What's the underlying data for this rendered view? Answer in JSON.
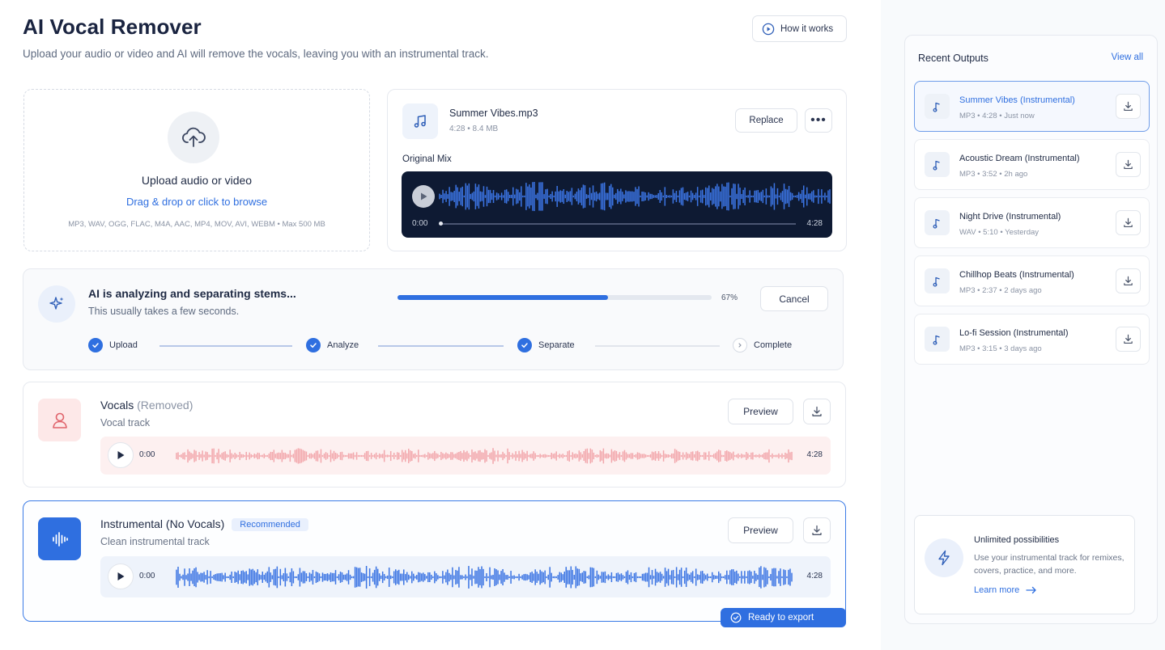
{
  "header": {
    "title": "AI Vocal Remover",
    "subtitle": "Upload your audio or video and AI  will remove the vocals, leaving you with an instrumental track.",
    "how_it_works": "How it works"
  },
  "upload": {
    "title": "Upload audio or video",
    "link": "Drag & drop or click to browse",
    "formats": "MP3, WAV, OGG, FLAC, M4A, AAC, MP4, MOV, AVI, WEBM • Max 500 MB"
  },
  "file": {
    "name": "Summer Vibes.mp3",
    "meta": "4:28  •  8.4 MB",
    "replace": "Replace",
    "more": "•••",
    "original_label": "Original Mix",
    "time_current": "0:00",
    "time_total": "4:28"
  },
  "progress": {
    "title": "AI is analyzing and separating stems...",
    "subtitle": "This usually takes a few seconds.",
    "percent_value": 67,
    "percent_label": "67%",
    "cancel": "Cancel",
    "steps": [
      {
        "label": "Upload",
        "done": true
      },
      {
        "label": "Analyze",
        "done": true
      },
      {
        "label": "Separate",
        "done": true
      },
      {
        "label": "Complete",
        "done": false
      }
    ]
  },
  "vocals": {
    "title": "Vocals",
    "title_suffix": "(Removed)",
    "subtitle": "Vocal track",
    "preview": "Preview",
    "time_current": "0:00",
    "time_total": "4:28",
    "wave_color": "#f2a7ac"
  },
  "instrumental": {
    "title": "Instrumental (No Vocals)",
    "badge": "Recommended",
    "subtitle": "Clean instrumental track",
    "preview": "Preview",
    "time_current": "0:00",
    "time_total": "4:28",
    "wave_color": "#3b74e3",
    "ready": "Ready to export"
  },
  "recent": {
    "title": "Recent Outputs",
    "view_all": "View all",
    "items": [
      {
        "name": "Summer Vibes (Instrumental)",
        "meta": "MP3  •  4:28  •  Just now",
        "active": true
      },
      {
        "name": "Acoustic Dream (Instrumental)",
        "meta": "MP3  •  3:52  •  2h ago",
        "active": false
      },
      {
        "name": "Night Drive (Instrumental)",
        "meta": "WAV  •  5:10  •  Yesterday",
        "active": false
      },
      {
        "name": "Chillhop Beats (Instrumental)",
        "meta": "MP3  •  2:37  •  2 days ago",
        "active": false
      },
      {
        "name": "Lo-fi Session (Instrumental)",
        "meta": "MP3  •  3:15  •  3 days ago",
        "active": false
      }
    ]
  },
  "promo": {
    "title": "Unlimited possibilities",
    "text": "Use your instrumental track for remixes, covers, practice, and more.",
    "link": "Learn more"
  },
  "colors": {
    "accent": "#2f6fe0",
    "dark_player": "#0e1a33",
    "original_wave": "#3b74e3"
  },
  "icons": {
    "how_it_works": "play-circle-icon",
    "upload": "cloud-upload-icon",
    "file": "music-note-icon",
    "analyzing": "sparkle-icon",
    "vocals": "user-icon",
    "instrumental": "waveform-icon",
    "download": "download-icon",
    "promo": "bolt-icon"
  }
}
